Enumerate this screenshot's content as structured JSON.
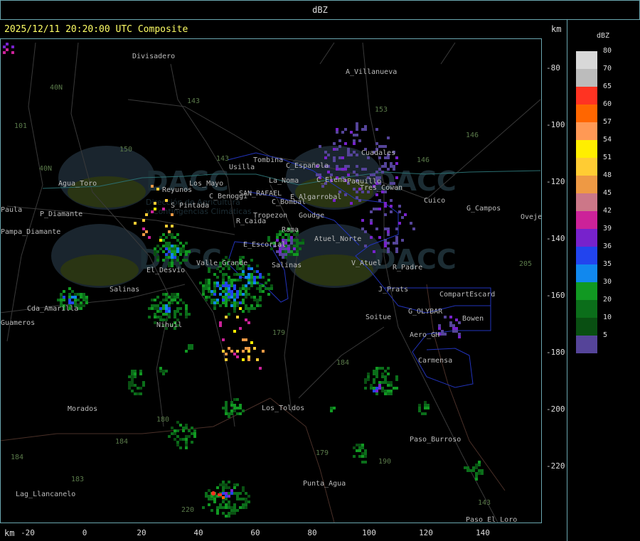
{
  "header": {
    "title": "dBZ"
  },
  "plot": {
    "timestamp": "2025/12/11 20:20:00 UTC Composite",
    "unit_top": "km",
    "unit_bottom": "km",
    "y_ticks": [
      "-80",
      "-100",
      "-120",
      "-140",
      "-160",
      "-180",
      "-200",
      "-220"
    ],
    "x_ticks": [
      "-20",
      "0",
      "20",
      "40",
      "60",
      "80",
      "100",
      "120",
      "140"
    ],
    "watermark": {
      "logo_text": "DACC",
      "line1": "Dirección de Agricultura",
      "line2": "y Contingencias Climáticas"
    }
  },
  "legend": {
    "unit": "dBZ",
    "entries": [
      {
        "label": "80",
        "color": "#d8d8d8"
      },
      {
        "label": "70",
        "color": "#bcbcbc"
      },
      {
        "label": "65",
        "color": "#ff3322"
      },
      {
        "label": "60",
        "color": "#ff6600"
      },
      {
        "label": "57",
        "color": "#ff9955"
      },
      {
        "label": "54",
        "color": "#ffee00"
      },
      {
        "label": "51",
        "color": "#ffcc33"
      },
      {
        "label": "48",
        "color": "#ee9944"
      },
      {
        "label": "45",
        "color": "#cc7788"
      },
      {
        "label": "42",
        "color": "#cc2299"
      },
      {
        "label": "39",
        "color": "#7722cc"
      },
      {
        "label": "36",
        "color": "#2244ee"
      },
      {
        "label": "35",
        "color": "#1188ee"
      },
      {
        "label": "30",
        "color": "#119922"
      },
      {
        "label": "20",
        "color": "#0b6e1a"
      },
      {
        "label": "10",
        "color": "#094f12"
      },
      {
        "label": "5",
        "color": "#554499"
      }
    ]
  },
  "places": [
    {
      "name": "Divisadero"
    },
    {
      "name": "A_Villanueva"
    },
    {
      "name": "Tombina"
    },
    {
      "name": "Usilla"
    },
    {
      "name": "C_Española"
    },
    {
      "name": "Cuadales"
    },
    {
      "name": "La_Noma"
    },
    {
      "name": "C_Elena"
    },
    {
      "name": "Paquillo"
    },
    {
      "name": "Agua_Toro"
    },
    {
      "name": "Reyunos"
    },
    {
      "name": "Los_Mayo"
    },
    {
      "name": "C_Benoggi"
    },
    {
      "name": "SAN_RAFAEL"
    },
    {
      "name": "E_Algarrobal"
    },
    {
      "name": "C_Bombal"
    },
    {
      "name": "Tres_Cowan"
    },
    {
      "name": "Cuico"
    },
    {
      "name": "G_Campos"
    },
    {
      "name": "Ovejeros"
    },
    {
      "name": "S_Pintada"
    },
    {
      "name": "Tropezon"
    },
    {
      "name": "Goudge"
    },
    {
      "name": "R_Caida"
    },
    {
      "name": "Pampa_Diamante"
    },
    {
      "name": "P_Diamante"
    },
    {
      "name": "Rama"
    },
    {
      "name": "Atuel_Norte"
    },
    {
      "name": "E_Escorial"
    },
    {
      "name": "Valle_Grande"
    },
    {
      "name": "Salinas"
    },
    {
      "name": "V_Atuel"
    },
    {
      "name": "R_Padre"
    },
    {
      "name": "El_Desvio"
    },
    {
      "name": "Salinas"
    },
    {
      "name": "J_Prats"
    },
    {
      "name": "CompartEscard"
    },
    {
      "name": "Cda_Amarilla"
    },
    {
      "name": "Guameros"
    },
    {
      "name": "Nihuil"
    },
    {
      "name": "Soitue"
    },
    {
      "name": "G_OLYBAR"
    },
    {
      "name": "Bowen"
    },
    {
      "name": "Aero_GH"
    },
    {
      "name": "Carmensa"
    },
    {
      "name": "Morados"
    },
    {
      "name": "Los_Toldos"
    },
    {
      "name": "Paso_Burroso"
    },
    {
      "name": "Punta_Agua"
    },
    {
      "name": "Lag_Llancanelo"
    },
    {
      "name": "Paso_El_Loro"
    },
    {
      "name": "Paula"
    }
  ],
  "routes": [
    "40N",
    "40N",
    "101",
    "153",
    "143",
    "146",
    "150",
    "143",
    "146",
    "179",
    "184",
    "180",
    "184",
    "183",
    "184",
    "190",
    "179",
    "143",
    "205",
    "220"
  ]
}
